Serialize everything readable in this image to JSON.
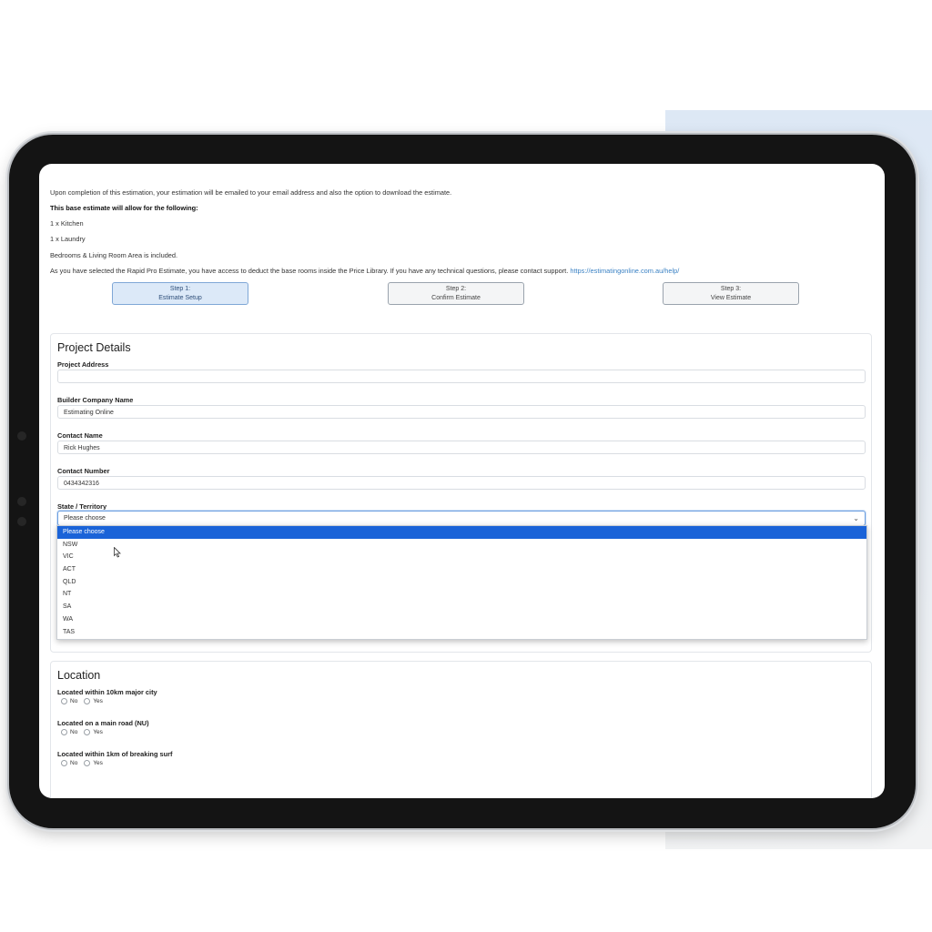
{
  "intro": {
    "completion_text": "Upon completion of this estimation, your estimation will be emailed to your email address and also the option to download the estimate.",
    "allow_heading": "This base estimate will allow for the following:",
    "kitchen": "1 x Kitchen",
    "laundry": "1 x Laundry",
    "bedrooms": "Bedrooms & Living Room Area is included.",
    "support_text": "As you have selected the Rapid Pro Estimate, you have access to deduct the base rooms inside the Price Library. If you have any technical questions, please contact support.",
    "support_link": "https://estimatingonline.com.au/help/"
  },
  "steps": [
    {
      "line1": "Step 1:",
      "line2": "Estimate Setup",
      "active": true
    },
    {
      "line1": "Step 2:",
      "line2": "Confirm Estimate",
      "active": false
    },
    {
      "line1": "Step 3:",
      "line2": "View Estimate",
      "active": false
    }
  ],
  "project_details": {
    "title": "Project Details",
    "address_label": "Project Address",
    "address_value": "",
    "company_label": "Builder Company Name",
    "company_value": "Estimating Online",
    "contact_name_label": "Contact Name",
    "contact_name_value": "Rick Hughes",
    "contact_number_label": "Contact Number",
    "contact_number_value": "0434342316",
    "state_label": "State / Territory",
    "state_value": "Please choose",
    "state_options": [
      "Please choose",
      "NSW",
      "VIC",
      "ACT",
      "QLD",
      "NT",
      "SA",
      "WA",
      "TAS"
    ]
  },
  "location": {
    "title": "Location",
    "q1": "Located within 10km major city",
    "q2": "Located on a main road (NU)",
    "q3": "Located within 1km of breaking surf",
    "no_label": "No",
    "yes_label": "Yes"
  },
  "colors": {
    "accent": "#1a63d8",
    "link": "#3b82c4",
    "step_active_bg": "#dce9f8"
  }
}
